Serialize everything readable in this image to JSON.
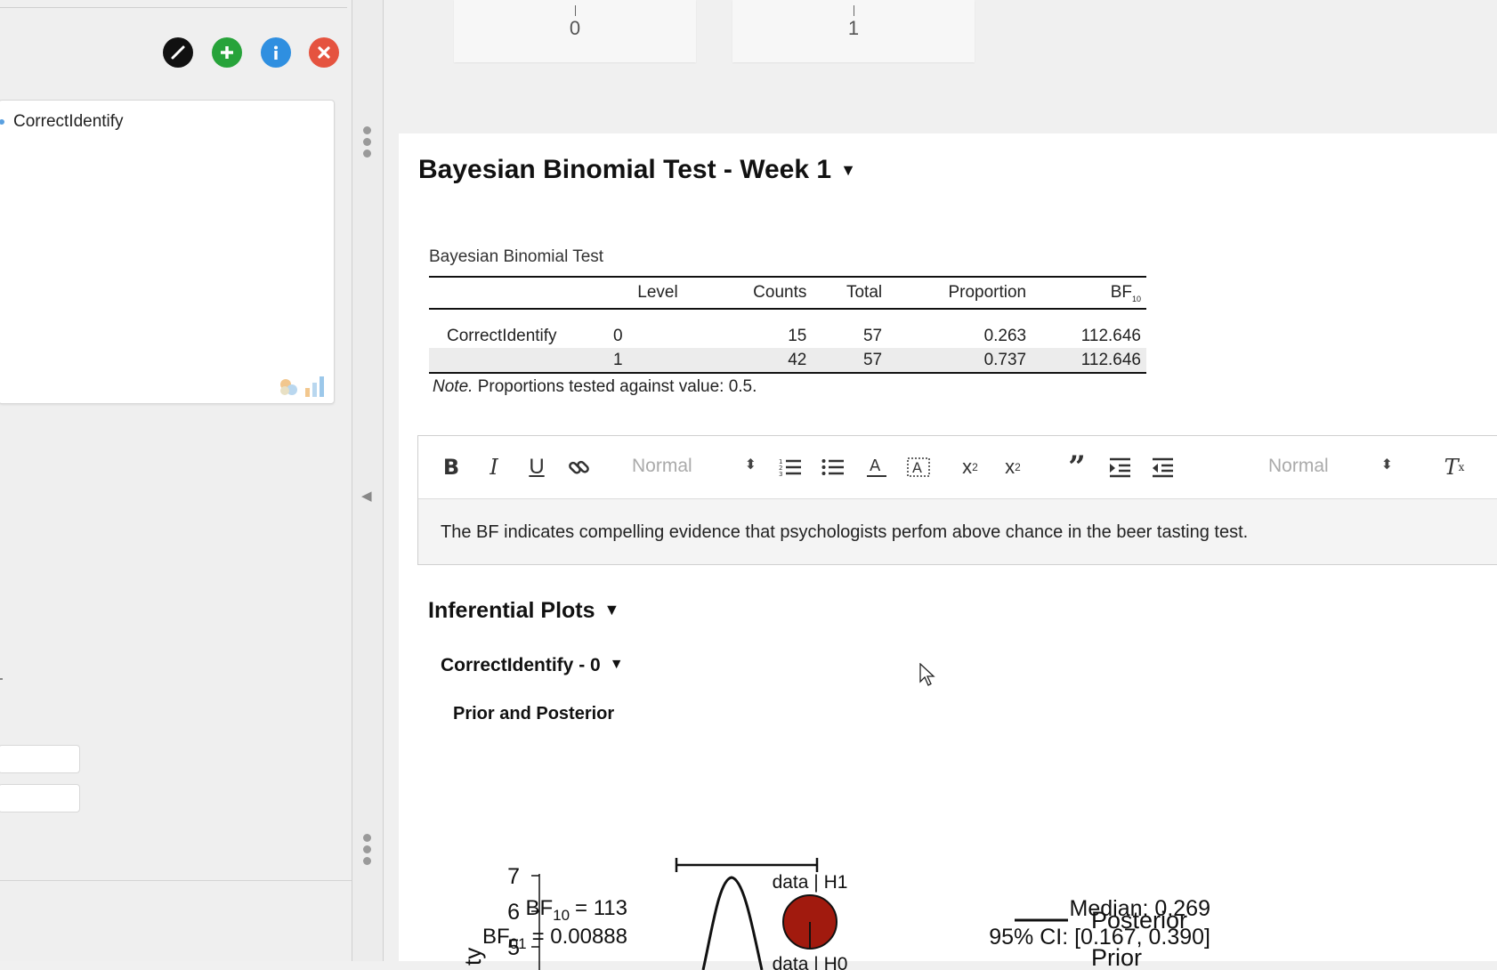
{
  "left_panel": {
    "variables": [
      "CorrectIdentify"
    ]
  },
  "histogram_tiles": [
    "0",
    "1"
  ],
  "analysis": {
    "title": "Bayesian Binomial Test - Week 1",
    "table": {
      "title": "Bayesian Binomial Test",
      "headers": [
        "",
        "Level",
        "Counts",
        "Total",
        "Proportion",
        "BF"
      ],
      "bf_subscript": "10",
      "rows": [
        {
          "variable": "CorrectIdentify",
          "level": "0",
          "counts": "15",
          "total": "57",
          "proportion": "0.263",
          "bf": "112.646"
        },
        {
          "variable": "",
          "level": "1",
          "counts": "42",
          "total": "57",
          "proportion": "0.737",
          "bf": "112.646"
        }
      ],
      "note_label": "Note.",
      "note_text": " Proportions tested against value: 0.5."
    },
    "editor": {
      "style_select": "Normal",
      "size_select": "Normal",
      "text": "The BF indicates compelling evidence that psychologists perfom above chance in the beer tasting test."
    },
    "inferential": {
      "title": "Inferential Plots",
      "subtitle": "CorrectIdentify - 0",
      "plot_title": "Prior and Posterior",
      "plot": {
        "bf10_label": "BF",
        "bf10_sub": "10",
        "bf10_value": "= 113",
        "bf01_label": "BF",
        "bf01_sub": "01",
        "bf01_value": "= 0.00888",
        "pie_top": "data | H1",
        "pie_bottom": "data | H0",
        "median": "Median: 0.269",
        "ci": "95% CI: [0.167, 0.390]",
        "y_ticks": [
          "7",
          "6",
          "5"
        ],
        "ylabel": "ty",
        "legend": [
          "Posterior",
          "Prior"
        ],
        "colors": {
          "pie_fill": "#a11a0e"
        }
      }
    }
  }
}
